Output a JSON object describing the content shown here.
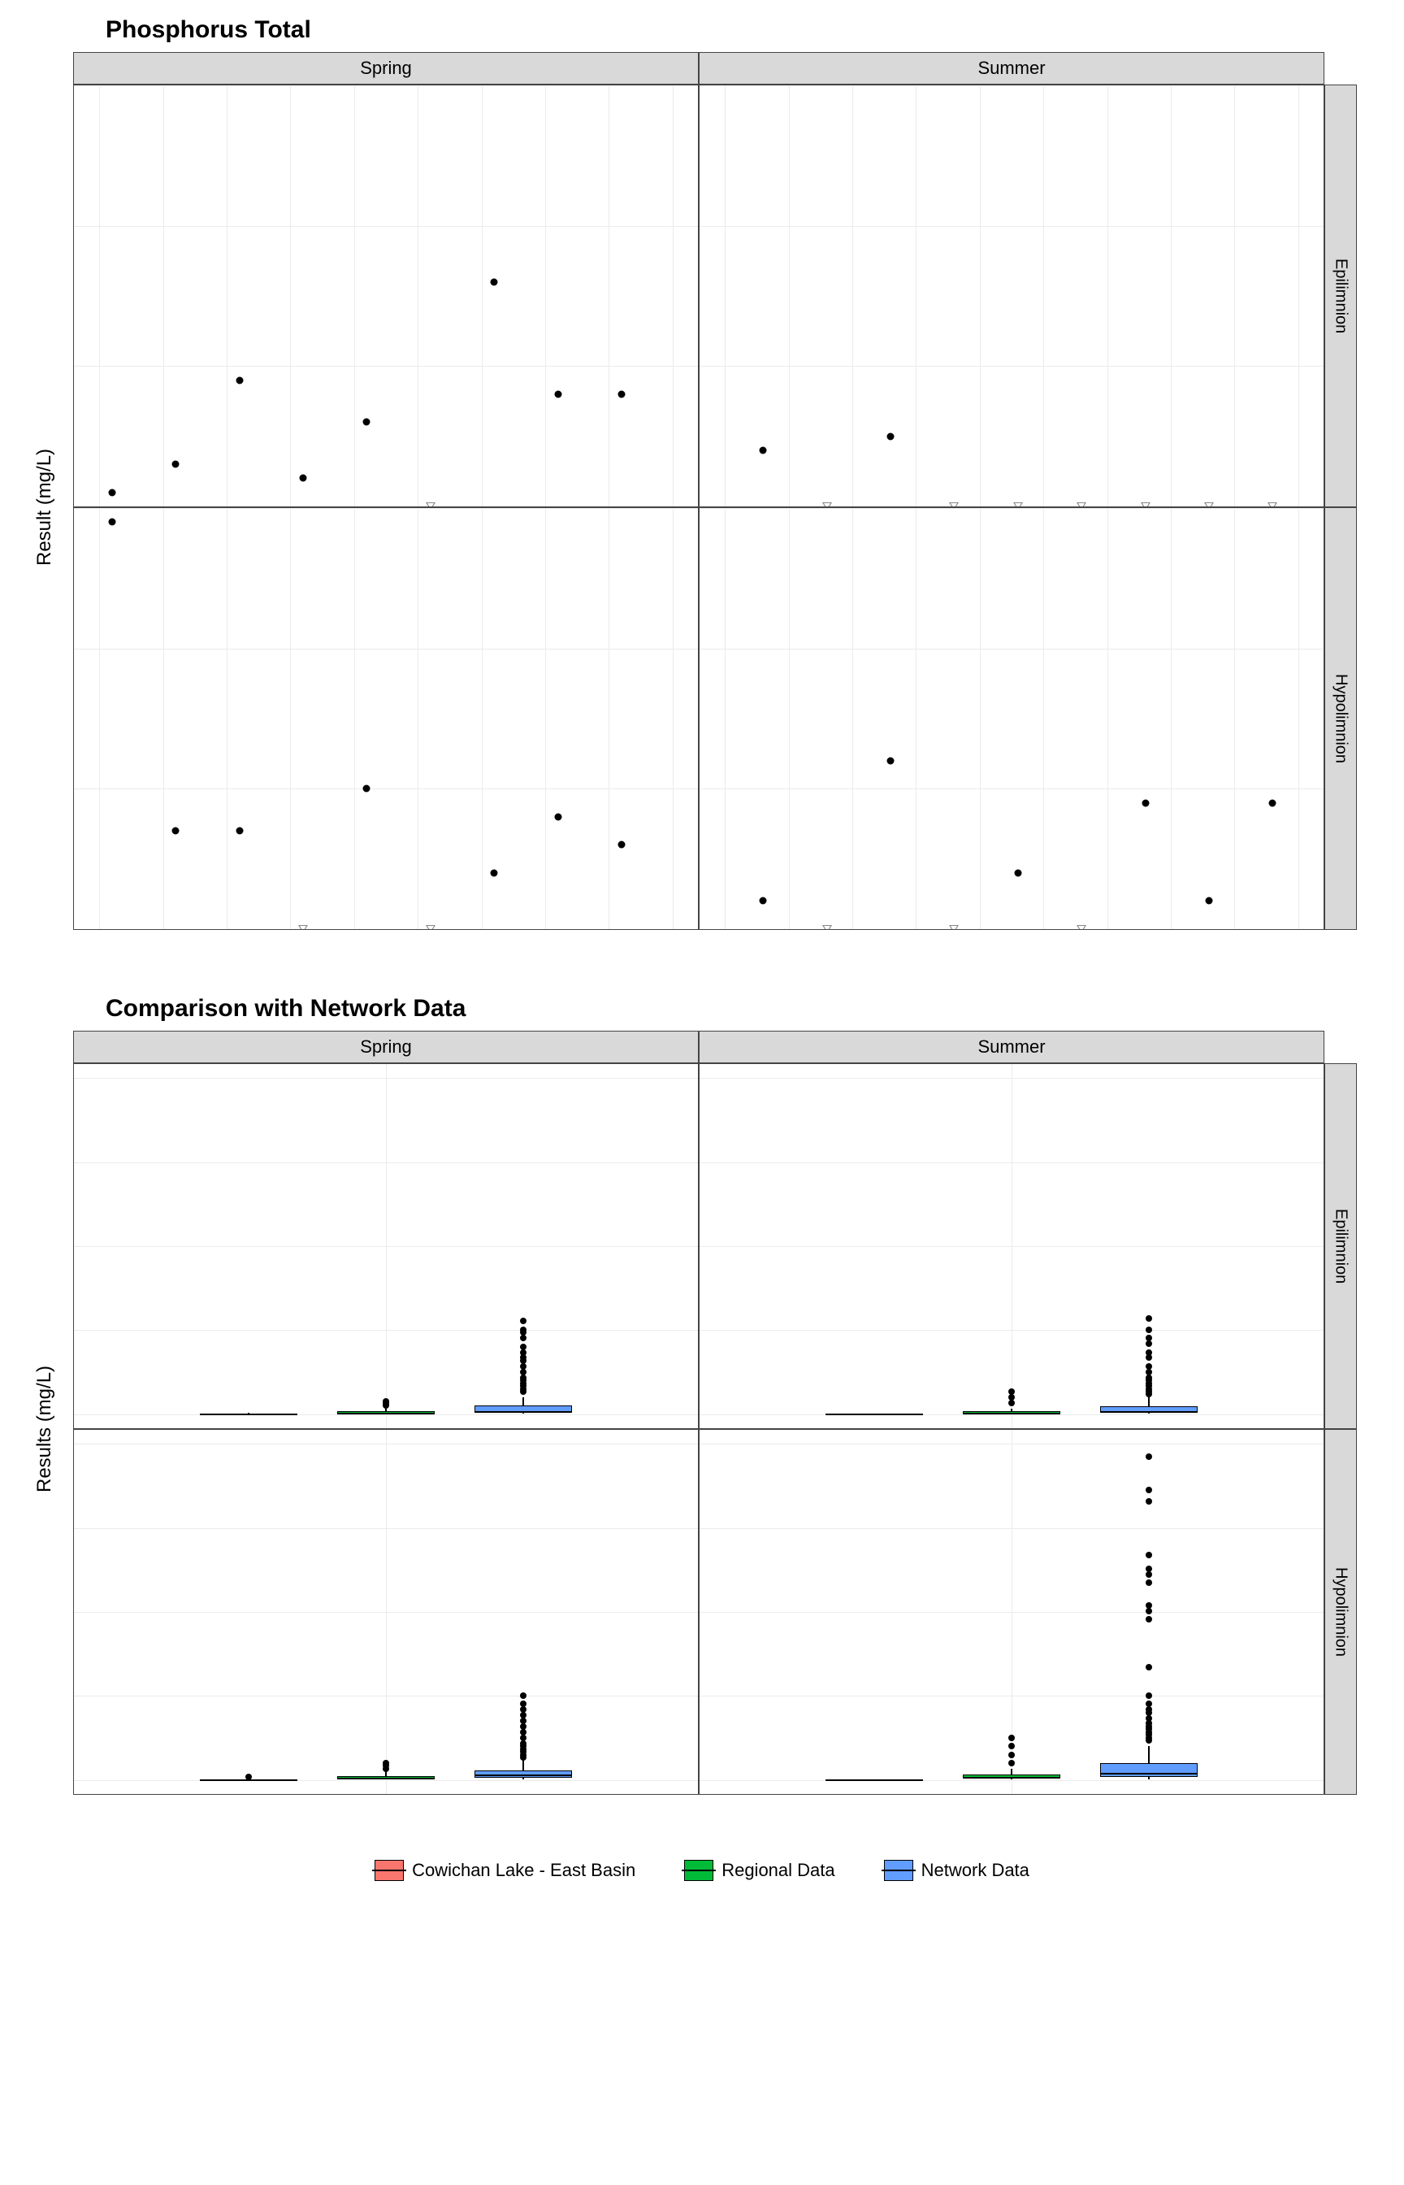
{
  "chart_data": [
    {
      "type": "scatter",
      "title": "Phosphorus Total",
      "ylabel": "Result (mg/L)",
      "xlabel": "",
      "col_facets": [
        "Spring",
        "Summer"
      ],
      "row_facets": [
        "Epilimnion",
        "Hypolimnion"
      ],
      "x_ticks": [
        2016,
        2017,
        2018,
        2019,
        2020,
        2021,
        2022,
        2023,
        2024,
        2025
      ],
      "y_ticks": [
        0.002,
        0.003,
        0.004,
        0.005
      ],
      "ylim": [
        0.002,
        0.005
      ],
      "xlim": [
        2015.6,
        2025.4
      ],
      "panels": {
        "Spring_Epilimnion": {
          "dots": [
            [
              2016.2,
              0.0021
            ],
            [
              2017.2,
              0.0023
            ],
            [
              2018.2,
              0.0029
            ],
            [
              2019.2,
              0.0022
            ],
            [
              2020.2,
              0.0026
            ],
            [
              2022.2,
              0.0036
            ],
            [
              2023.2,
              0.0028
            ],
            [
              2024.2,
              0.0028
            ]
          ],
          "tris": [
            [
              2021.2,
              0.002
            ]
          ]
        },
        "Summer_Epilimnion": {
          "dots": [
            [
              2016.6,
              0.0024
            ],
            [
              2018.6,
              0.0025
            ]
          ],
          "tris": [
            [
              2017.6,
              0.002
            ],
            [
              2019.6,
              0.002
            ],
            [
              2020.6,
              0.002
            ],
            [
              2021.6,
              0.002
            ],
            [
              2022.6,
              0.002
            ],
            [
              2023.6,
              0.002
            ],
            [
              2024.6,
              0.002
            ]
          ]
        },
        "Spring_Hypolimnion": {
          "dots": [
            [
              2016.2,
              0.0049
            ],
            [
              2017.2,
              0.0027
            ],
            [
              2018.2,
              0.0027
            ],
            [
              2020.2,
              0.003
            ],
            [
              2022.2,
              0.0024
            ],
            [
              2023.2,
              0.0028
            ],
            [
              2024.2,
              0.0026
            ]
          ],
          "tris": [
            [
              2019.2,
              0.002
            ],
            [
              2021.2,
              0.002
            ]
          ]
        },
        "Summer_Hypolimnion": {
          "dots": [
            [
              2016.6,
              0.0022
            ],
            [
              2018.6,
              0.0032
            ],
            [
              2020.6,
              0.0024
            ],
            [
              2022.6,
              0.0029
            ],
            [
              2023.6,
              0.0022
            ],
            [
              2024.6,
              0.0029
            ]
          ],
          "tris": [
            [
              2017.6,
              0.002
            ],
            [
              2019.6,
              0.002
            ],
            [
              2021.6,
              0.002
            ]
          ]
        }
      }
    },
    {
      "type": "boxplot",
      "title": "Comparison with Network Data",
      "ylabel": "Results (mg/L)",
      "xlabel": "",
      "col_facets": [
        "Spring",
        "Summer"
      ],
      "row_facets": [
        "Epilimnion",
        "Hypolimnion"
      ],
      "x_category": "Phosphorus Total",
      "y_ticks": [
        0.0,
        0.3,
        0.6,
        0.9,
        1.2
      ],
      "ylim": [
        -0.05,
        1.25
      ],
      "groups": [
        "Cowichan Lake - East Basin",
        "Regional Data",
        "Network Data"
      ],
      "colors": {
        "Cowichan Lake - East Basin": "#f8766d",
        "Regional Data": "#00ba38",
        "Network Data": "#619cff"
      },
      "panels": {
        "Spring_Epilimnion": {
          "boxes": [
            {
              "group": "Cowichan Lake - East Basin",
              "q1": 0.002,
              "med": 0.003,
              "q3": 0.003,
              "lw": 0.002,
              "uw": 0.004,
              "out": []
            },
            {
              "group": "Regional Data",
              "q1": 0.003,
              "med": 0.005,
              "q3": 0.01,
              "lw": 0.002,
              "uw": 0.02,
              "out": [
                0.03,
                0.035,
                0.04,
                0.045
              ]
            },
            {
              "group": "Network Data",
              "q1": 0.005,
              "med": 0.012,
              "q3": 0.03,
              "lw": 0.002,
              "uw": 0.06,
              "out": [
                0.08,
                0.09,
                0.1,
                0.11,
                0.12,
                0.13,
                0.15,
                0.17,
                0.19,
                0.2,
                0.22,
                0.24,
                0.27,
                0.29,
                0.3,
                0.33
              ]
            }
          ]
        },
        "Summer_Epilimnion": {
          "boxes": [
            {
              "group": "Cowichan Lake - East Basin",
              "q1": 0.002,
              "med": 0.002,
              "q3": 0.003,
              "lw": 0.002,
              "uw": 0.003,
              "out": []
            },
            {
              "group": "Regional Data",
              "q1": 0.003,
              "med": 0.005,
              "q3": 0.01,
              "lw": 0.002,
              "uw": 0.02,
              "out": [
                0.04,
                0.06,
                0.08
              ]
            },
            {
              "group": "Network Data",
              "q1": 0.005,
              "med": 0.012,
              "q3": 0.028,
              "lw": 0.002,
              "uw": 0.06,
              "out": [
                0.07,
                0.08,
                0.09,
                0.1,
                0.11,
                0.12,
                0.13,
                0.15,
                0.17,
                0.2,
                0.22,
                0.25,
                0.27,
                0.3,
                0.34
              ]
            }
          ]
        },
        "Spring_Hypolimnion": {
          "boxes": [
            {
              "group": "Cowichan Lake - East Basin",
              "q1": 0.002,
              "med": 0.003,
              "q3": 0.003,
              "lw": 0.002,
              "uw": 0.005,
              "out": [
                0.01
              ]
            },
            {
              "group": "Regional Data",
              "q1": 0.004,
              "med": 0.008,
              "q3": 0.015,
              "lw": 0.002,
              "uw": 0.03,
              "out": [
                0.04,
                0.05,
                0.06
              ]
            },
            {
              "group": "Network Data",
              "q1": 0.008,
              "med": 0.018,
              "q3": 0.035,
              "lw": 0.002,
              "uw": 0.07,
              "out": [
                0.08,
                0.09,
                0.1,
                0.11,
                0.12,
                0.13,
                0.15,
                0.17,
                0.19,
                0.21,
                0.23,
                0.25,
                0.27,
                0.3
              ]
            }
          ]
        },
        "Summer_Hypolimnion": {
          "boxes": [
            {
              "group": "Cowichan Lake - East Basin",
              "q1": 0.002,
              "med": 0.003,
              "q3": 0.003,
              "lw": 0.002,
              "uw": 0.003,
              "out": []
            },
            {
              "group": "Regional Data",
              "q1": 0.004,
              "med": 0.01,
              "q3": 0.02,
              "lw": 0.002,
              "uw": 0.04,
              "out": [
                0.06,
                0.09,
                0.12,
                0.15
              ]
            },
            {
              "group": "Network Data",
              "q1": 0.01,
              "med": 0.025,
              "q3": 0.06,
              "lw": 0.002,
              "uw": 0.12,
              "out": [
                0.14,
                0.15,
                0.16,
                0.17,
                0.18,
                0.19,
                0.2,
                0.22,
                0.24,
                0.25,
                0.27,
                0.3,
                0.4,
                0.57,
                0.6,
                0.62,
                0.7,
                0.73,
                0.75,
                0.8,
                0.99,
                1.03,
                1.15
              ]
            }
          ]
        }
      }
    }
  ],
  "legend": {
    "items": [
      {
        "label": "Cowichan Lake - East Basin",
        "color": "#f8766d"
      },
      {
        "label": "Regional Data",
        "color": "#00ba38"
      },
      {
        "label": "Network Data",
        "color": "#619cff"
      }
    ]
  }
}
